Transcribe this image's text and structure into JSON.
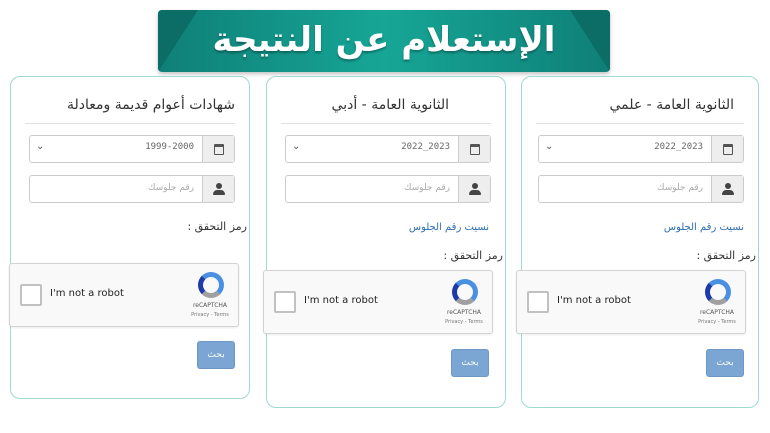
{
  "banner": {
    "title": "الإستعلام عن النتيجة"
  },
  "cards": [
    {
      "title": "شهادات أعوام قديمة ومعادلة",
      "year_value": "1999-2000",
      "seat_placeholder": "رقم جلوسك",
      "verify_label": "رمز التحقق :",
      "recaptcha_label": "I'm not a robot",
      "recaptcha_brand": "reCAPTCHA",
      "recaptcha_terms": "Privacy - Terms",
      "submit_label": "بحث"
    },
    {
      "title": "الثانوية العامة - أدبي",
      "year_value": "2022_2023",
      "seat_placeholder": "رقم جلوسك",
      "forgot_label": "نسيت رقم الجلوس",
      "verify_label": "رمز التحقق :",
      "recaptcha_label": "I'm not a robot",
      "recaptcha_brand": "reCAPTCHA",
      "recaptcha_terms": "Privacy - Terms",
      "submit_label": "بحث"
    },
    {
      "title": "الثانوية العامة - علمي",
      "year_value": "2022_2023",
      "seat_placeholder": "رقم جلوسك",
      "forgot_label": "نسيت رقم الجلوس",
      "verify_label": "رمز التحقق :",
      "recaptcha_label": "I'm not a robot",
      "recaptcha_brand": "reCAPTCHA",
      "recaptcha_terms": "Privacy - Terms",
      "submit_label": "بحث"
    }
  ],
  "icons": {
    "year": "calendar-icon",
    "seat": "user-icon",
    "dropdown": "chevron-down-icon",
    "recaptcha": "recaptcha-logo-icon"
  },
  "colors": {
    "banner": "#16a696",
    "card_border": "#9fd9d1",
    "link": "#2c6db3",
    "submit": "#7ba6d3"
  }
}
